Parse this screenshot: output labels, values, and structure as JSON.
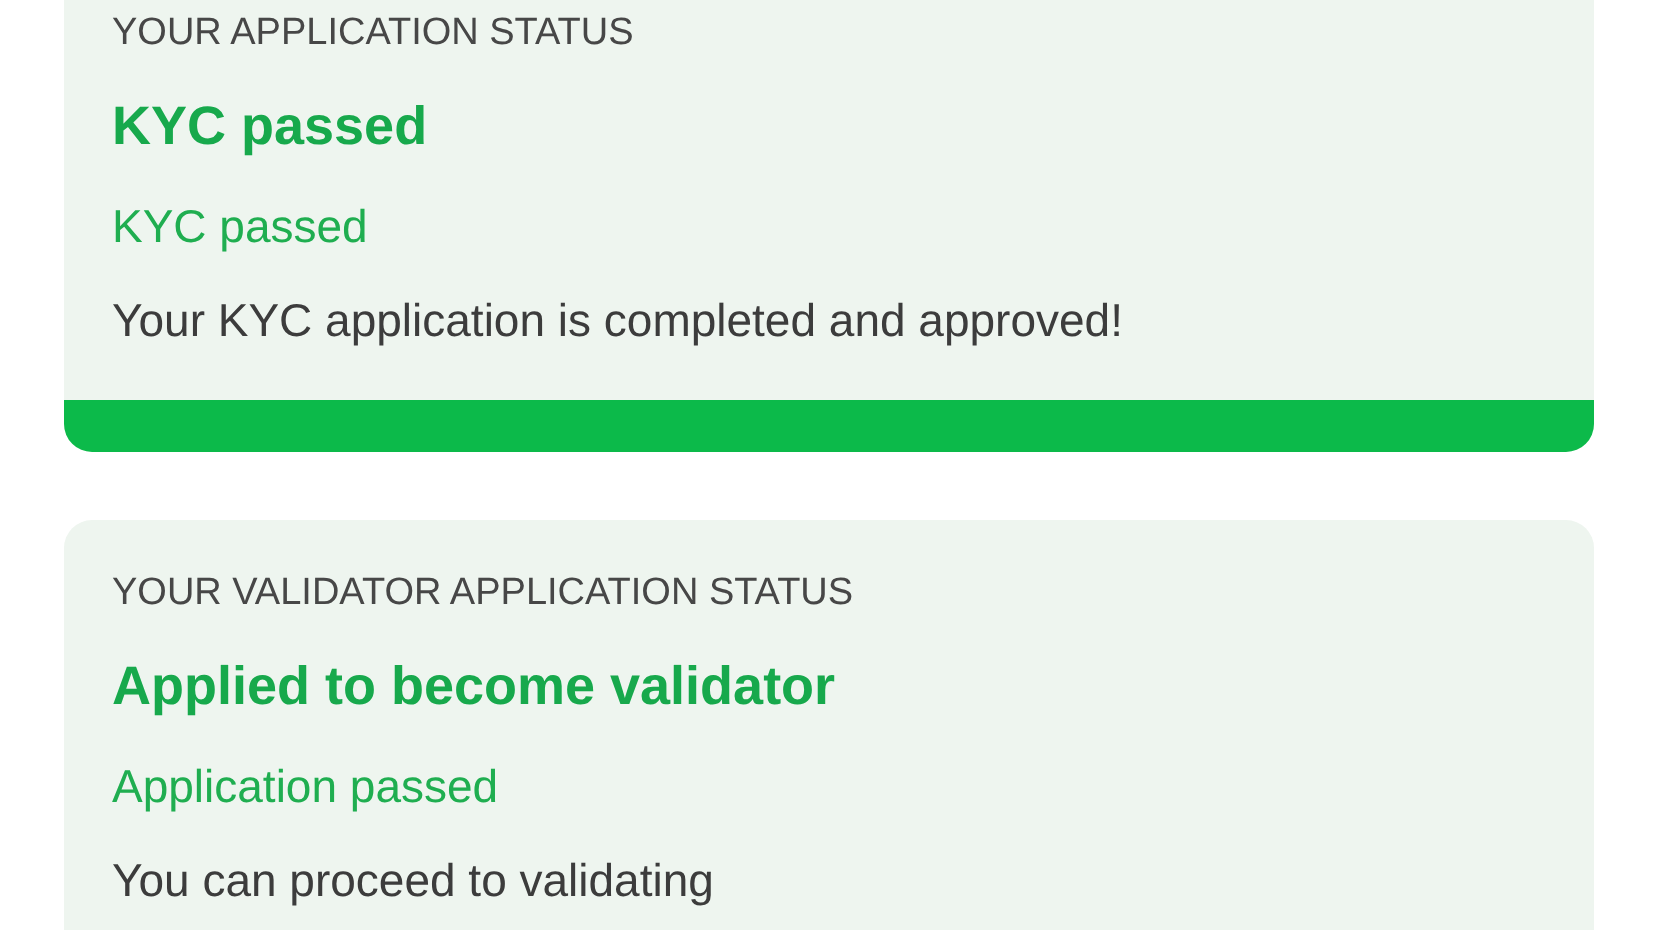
{
  "cards": [
    {
      "label": "YOUR APPLICATION STATUS",
      "title": "KYC passed",
      "status": "KYC passed",
      "message": "Your KYC application is completed and approved!",
      "progress": {
        "level": 1
      }
    },
    {
      "label": "YOUR VALIDATOR APPLICATION STATUS",
      "title": "Applied to become validator",
      "status": "Application passed",
      "message": "You can proceed to validating"
    }
  ]
}
